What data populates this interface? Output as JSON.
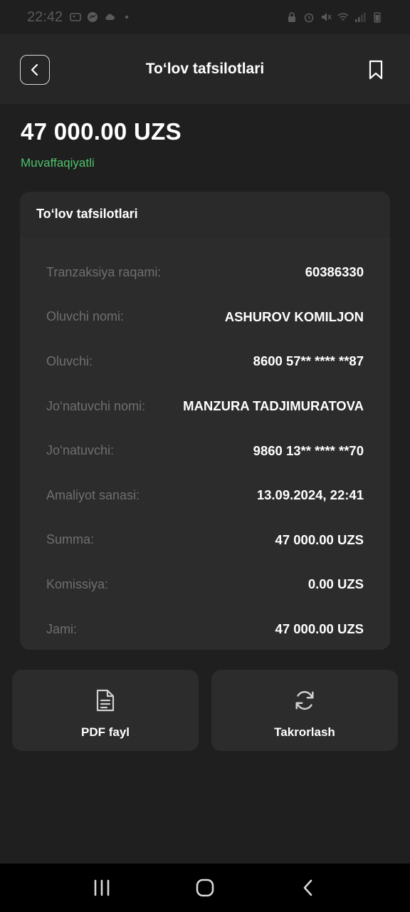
{
  "status_bar": {
    "time": "22:42",
    "left_icons": [
      "gallery-icon",
      "messenger-icon",
      "cloud-icon",
      "dot-icon"
    ],
    "right_icons": [
      "lock-icon",
      "alarm-icon",
      "mute-icon",
      "wifi-icon",
      "signal-icon",
      "battery-icon"
    ]
  },
  "header": {
    "title": "To‘lov tafsilotlari",
    "back_icon": "chevron-left-icon",
    "bookmark_icon": "bookmark-icon"
  },
  "summary": {
    "amount": "47 000.00 UZS",
    "status": "Muvaffaqiyatli",
    "status_color": "#4cc26a"
  },
  "details": {
    "title": "To‘lov tafsilotlari",
    "rows": [
      {
        "label": "Tranzaksiya raqami:",
        "value": "60386330"
      },
      {
        "label": "Oluvchi nomi:",
        "value": "ASHUROV KOMILJON"
      },
      {
        "label": "Oluvchi:",
        "value": "8600 57** **** **87"
      },
      {
        "label": "Jo‘natuvchi nomi:",
        "value": "MANZURA TADJIMURATOVA"
      },
      {
        "label": "Jo‘natuvchi:",
        "value": "9860 13** **** **70"
      },
      {
        "label": "Amaliyot sanasi:",
        "value": "13.09.2024, 22:41"
      },
      {
        "label": "Summa:",
        "value": "47 000.00 UZS"
      },
      {
        "label": "Komissiya:",
        "value": "0.00 UZS"
      },
      {
        "label": "Jami:",
        "value": "47 000.00 UZS"
      }
    ]
  },
  "actions": {
    "pdf": {
      "label": "PDF fayl",
      "icon": "document-icon"
    },
    "repeat": {
      "label": "Takrorlash",
      "icon": "refresh-icon"
    }
  },
  "nav": {
    "recents_icon": "recents-icon",
    "home_icon": "home-icon",
    "back_icon": "back-icon"
  }
}
